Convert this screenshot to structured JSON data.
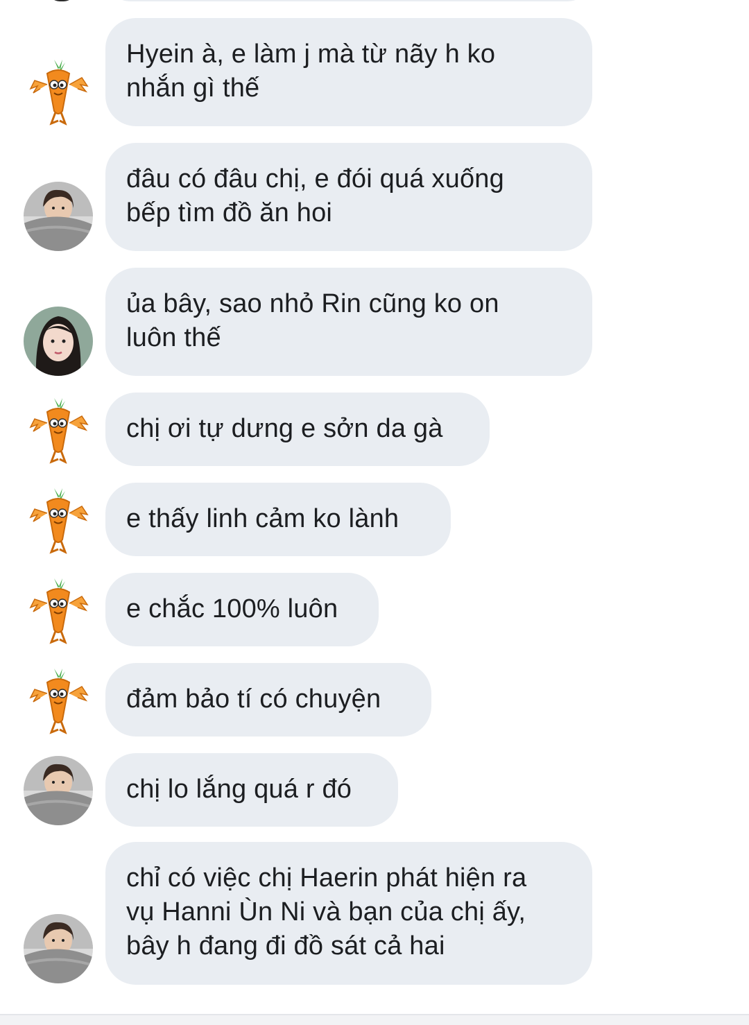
{
  "conversation": {
    "messages": [
      {
        "sender": "carrot",
        "text": "Hyein à, e làm j mà từ nãy h ko\nnhắn gì thế"
      },
      {
        "sender": "girl-bed",
        "text": "đâu có đâu chị, e đói quá xuống\nbếp tìm đồ ăn hoi"
      },
      {
        "sender": "girl-selfie",
        "text": "ủa bây, sao nhỏ Rin cũng ko on\nluôn thế"
      },
      {
        "sender": "carrot",
        "text": "chị ơi tự dưng e sởn da gà"
      },
      {
        "sender": "carrot",
        "text": "e thấy linh cảm ko lành"
      },
      {
        "sender": "carrot",
        "text": "e chắc 100% luôn"
      },
      {
        "sender": "carrot",
        "text": "đảm bảo tí có chuyện"
      },
      {
        "sender": "girl-bed",
        "text": "chị lo lắng quá r đó"
      },
      {
        "sender": "girl-bed",
        "text": "chỉ có việc chị Haerin phát hiện ra\nvụ Hanni Ùn Ni và bạn của chị ấy,\nbây h đang đi đồ sát cả hai"
      }
    ]
  },
  "colors": {
    "bubble": "#e9edf2",
    "text": "#1c1e21",
    "background": "#ffffff",
    "carrot": "#f28a1e",
    "leaf": "#4caf50"
  },
  "avatars": {
    "carrot": "carrot-sticker-icon",
    "girl-bed": "girl-in-bed-avatar",
    "girl-selfie": "girl-selfie-avatar"
  }
}
